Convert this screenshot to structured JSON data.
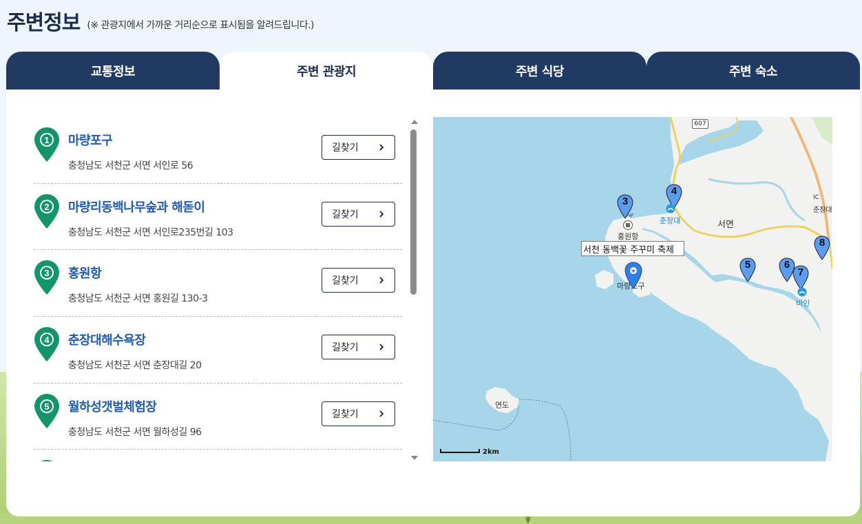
{
  "header": {
    "title": "주변정보",
    "note": "(※ 관광지에서 가까운 거리순으로 표시됨을 알려드립니다.)"
  },
  "tabs": [
    {
      "label": "교통정보",
      "active": false
    },
    {
      "label": "주변 관광지",
      "active": true
    },
    {
      "label": "주변 식당",
      "active": false
    },
    {
      "label": "주변 숙소",
      "active": false
    }
  ],
  "list": {
    "route_label": "길찾기",
    "items": [
      {
        "num": "1",
        "title": "마량포구",
        "address": "충청남도 서천군 서면 서인로 56"
      },
      {
        "num": "2",
        "title": "마량리동백나무숲과 해돋이",
        "address": "충청남도 서천군 서면 서인로235번길 103"
      },
      {
        "num": "3",
        "title": "홍원항",
        "address": "충청남도 서천군 서면 홍원길 130-3"
      },
      {
        "num": "4",
        "title": "춘장대해수욕장",
        "address": "충청남도 서천군 서면 춘장대길 20"
      },
      {
        "num": "5",
        "title": "월하성갯벌체험장",
        "address": "충청남도 서천군 서면 월하성길 96"
      }
    ]
  },
  "map": {
    "tooltip": "서천 동백꽃 주꾸미 축제",
    "labels": {
      "chunjangdae": "춘장대",
      "hongwonhang": "홍원항",
      "seomyeon": "서면",
      "maryangpogu": "마량포구",
      "bin": "비인",
      "yeondo": "연도",
      "chunjangdae_ic": "춘장대",
      "ic": "IC"
    },
    "road_number": "607",
    "scale": "2km",
    "markers": [
      "3",
      "4",
      "5",
      "6",
      "7",
      "8"
    ],
    "colors": {
      "sea": "#a7d6ea",
      "land": "#f2f2f0",
      "marker": "#5b9cf0",
      "current": "#2f7fe8"
    }
  },
  "colors": {
    "tab_bg": "#213a63",
    "title_blue": "#1f5bb5",
    "pin_green": "#12956b"
  }
}
